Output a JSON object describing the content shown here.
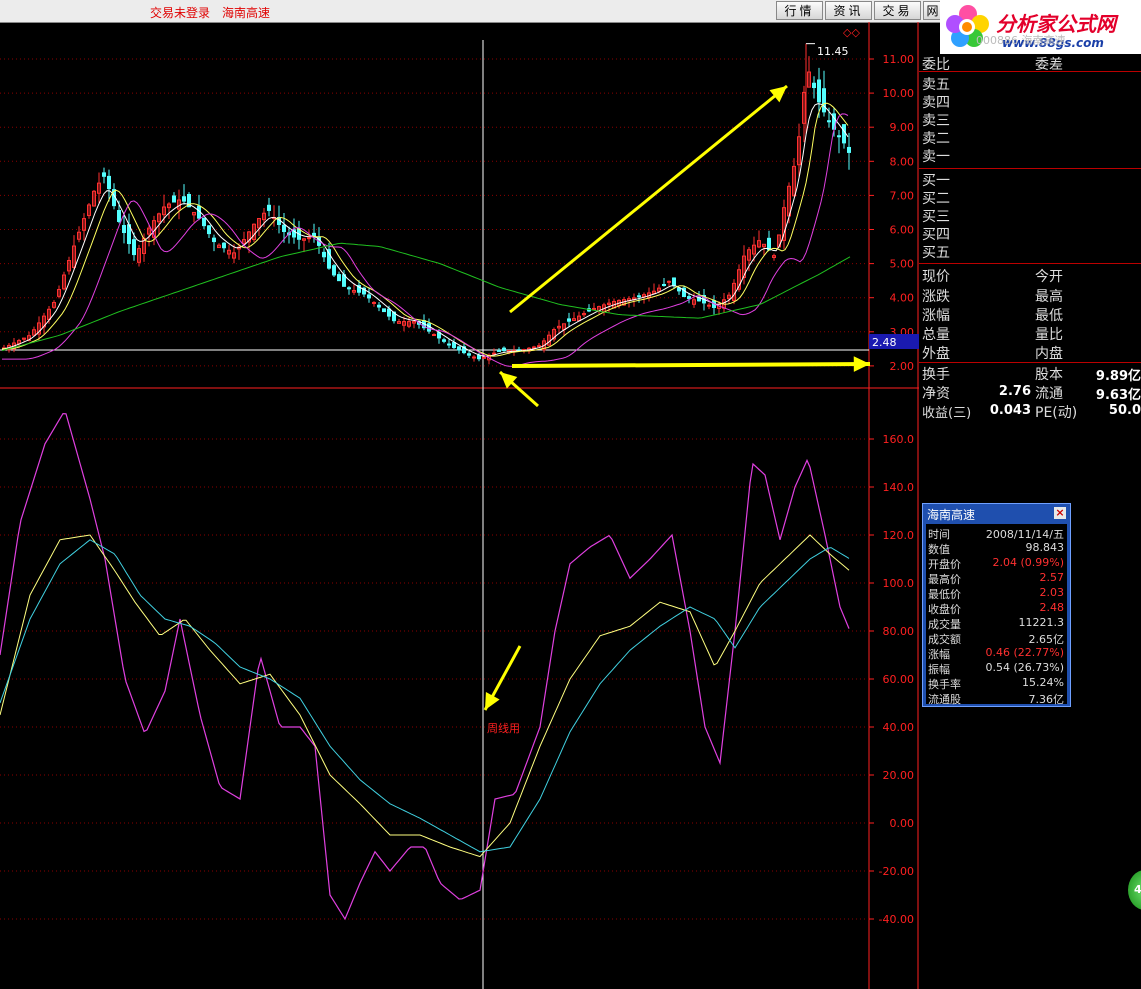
{
  "topbar": {
    "status_text": "交易未登录",
    "stock_name": "海南高速",
    "buttons": [
      {
        "label": "行情"
      },
      {
        "label": "资讯"
      },
      {
        "label": "交易"
      },
      {
        "label": "网"
      }
    ]
  },
  "logo": {
    "brand_text": "分析家公式网",
    "url_text": "www.88gs.com",
    "code_text": "000886 海南高速"
  },
  "colors": {
    "background": "#000000",
    "grid_red": "#8b0000",
    "axis_red": "#ff2020",
    "candle_up": "#ff3030",
    "candle_down": "#54ffff",
    "ma_white": "#ffffff",
    "ma_yellow": "#ffff60",
    "ma_magenta": "#e040e0",
    "ma_green": "#20c020",
    "osc_magenta": "#e040e0",
    "osc_yellow": "#ffff80",
    "osc_cyan": "#40d0e0",
    "arrow_yellow": "#ffff00",
    "popup_blue": "#1f4fae"
  },
  "price_chart": {
    "y_ticks": [
      "11.00",
      "10.00",
      "9.00",
      "8.00",
      "7.00",
      "6.00",
      "5.00",
      "4.00",
      "3.00",
      "2.00"
    ],
    "max_label": "11.45",
    "current_price_badge": "2.48"
  },
  "osc_chart": {
    "y_ticks": [
      "160.0",
      "140.0",
      "120.0",
      "100.0",
      "80.00",
      "60.00",
      "40.00",
      "20.00",
      "0.00",
      "-20.00",
      "-40.00"
    ],
    "annotation": "周线用"
  },
  "order_book": {
    "header": {
      "left": "委比",
      "right": "委差"
    },
    "sell": [
      "卖五",
      "卖四",
      "卖三",
      "卖二",
      "卖一"
    ],
    "buy": [
      "买一",
      "买二",
      "买三",
      "买四",
      "买五"
    ]
  },
  "quote": {
    "rows": [
      {
        "left": "现价",
        "right": "今开"
      },
      {
        "left": "涨跌",
        "right": "最高"
      },
      {
        "left": "涨幅",
        "right": "最低"
      },
      {
        "left": "总量",
        "right": "量比"
      },
      {
        "left": "外盘",
        "right": "内盘"
      }
    ]
  },
  "fundamentals": {
    "row1": {
      "label_a": "换手",
      "label_b": "股本",
      "value_b": "9.89亿"
    },
    "row2": {
      "label_a": "净资",
      "value_a": "2.76",
      "label_b": "流通",
      "value_b": "9.63亿"
    },
    "row3": {
      "label_a": "收益(三)",
      "value_a": "0.043",
      "label_b": "PE(动)",
      "value_b": "50.0"
    }
  },
  "info_popup": {
    "title": "海南高速",
    "close_label": "×",
    "rows": [
      {
        "label": "时间",
        "value": "2008/11/14/五",
        "color": "#dddddd"
      },
      {
        "label": "数值",
        "value": "98.843",
        "color": "#dddddd"
      },
      {
        "label": "开盘价",
        "value": "2.04 (0.99%)",
        "color": "#ff3030"
      },
      {
        "label": "最高价",
        "value": "2.57",
        "color": "#ff3030"
      },
      {
        "label": "最低价",
        "value": "2.03",
        "color": "#ff3030"
      },
      {
        "label": "收盘价",
        "value": "2.48",
        "color": "#ff3030"
      },
      {
        "label": "成交量",
        "value": "11221.3",
        "color": "#dddddd"
      },
      {
        "label": "成交额",
        "value": "2.65亿",
        "color": "#dddddd"
      },
      {
        "label": "涨幅",
        "value": "0.46 (22.77%)",
        "color": "#ff3030"
      },
      {
        "label": "振幅",
        "value": "0.54 (26.73%)",
        "color": "#dddddd"
      },
      {
        "label": "换手率",
        "value": "15.24%",
        "color": "#dddddd"
      },
      {
        "label": "流通股",
        "value": "7.36亿",
        "color": "#dddddd"
      }
    ]
  },
  "badge": {
    "text": "4"
  }
}
